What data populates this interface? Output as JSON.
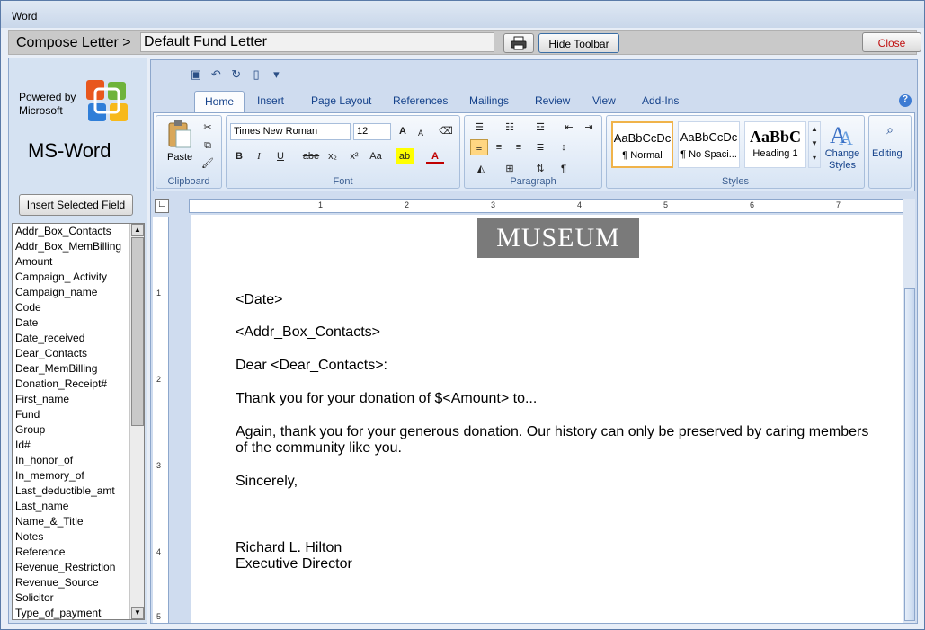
{
  "window": {
    "title": "Word"
  },
  "compose": {
    "label": "Compose Letter >",
    "letter_name": "Default Fund Letter",
    "print_icon": "printer-icon",
    "hide_toolbar": "Hide Toolbar",
    "close": "Close"
  },
  "sidebar": {
    "powered_line1": "Powered by",
    "powered_line2": "Microsoft",
    "logo_icon": "office-logo-icon",
    "product": "MS-Word",
    "insert_button": "Insert Selected Field",
    "fields": [
      "Addr_Box_Contacts",
      "Addr_Box_MemBilling",
      "Amount",
      "Campaign_ Activity",
      "Campaign_name",
      "Code",
      "Date",
      "Date_received",
      "Dear_Contacts",
      "Dear_MemBilling",
      "Donation_Receipt#",
      "First_name",
      "Fund",
      "Group",
      "Id#",
      "In_honor_of",
      "In_memory_of",
      "Last_deductible_amt",
      "Last_name",
      "Name_&_Title",
      "Notes",
      "Reference",
      "Revenue_Restriction",
      "Revenue_Source",
      "Solicitor",
      "Type_of_payment"
    ]
  },
  "ribbon": {
    "tabs": [
      "Home",
      "Insert",
      "Page Layout",
      "References",
      "Mailings",
      "Review",
      "View",
      "Add-Ins"
    ],
    "active_tab": "Home",
    "clipboard": {
      "paste": "Paste",
      "label": "Clipboard"
    },
    "font": {
      "name": "Times New Roman",
      "size": "12",
      "label": "Font",
      "bold": "B",
      "italic": "I",
      "underline": "U",
      "strike": "abe",
      "sub": "x₂",
      "sup": "x²",
      "case": "Aa",
      "grow": "A",
      "shrink": "A"
    },
    "paragraph": {
      "label": "Paragraph",
      "pilcrow": "¶"
    },
    "styles": {
      "label": "Styles",
      "items": [
        {
          "preview": "AaBbCcDc",
          "name": "¶ Normal"
        },
        {
          "preview": "AaBbCcDc",
          "name": "¶ No Spaci..."
        },
        {
          "preview": "AaBbC",
          "name": "Heading 1"
        }
      ],
      "change": "Change Styles"
    },
    "editing": {
      "label": "Editing"
    }
  },
  "ruler": {
    "numbers": [
      "1",
      "2",
      "3",
      "4",
      "5",
      "6",
      "7"
    ],
    "vnumbers": [
      "1",
      "2",
      "3",
      "4",
      "5"
    ]
  },
  "document": {
    "header_image_text": "MUSEUM",
    "line_date": "<Date>",
    "line_addr": "<Addr_Box_Contacts>",
    "line_dear": "Dear <Dear_Contacts>:",
    "line_thanks": "Thank you for your donation of $<Amount> to...",
    "line_again1": "Again, thank you for your generous donation.  Our history can only be preserved by caring members",
    "line_again2": "of the community like you.",
    "line_sincerely": "Sincerely,",
    "signer_name": "Richard L. Hilton",
    "signer_title": "Executive Director"
  }
}
